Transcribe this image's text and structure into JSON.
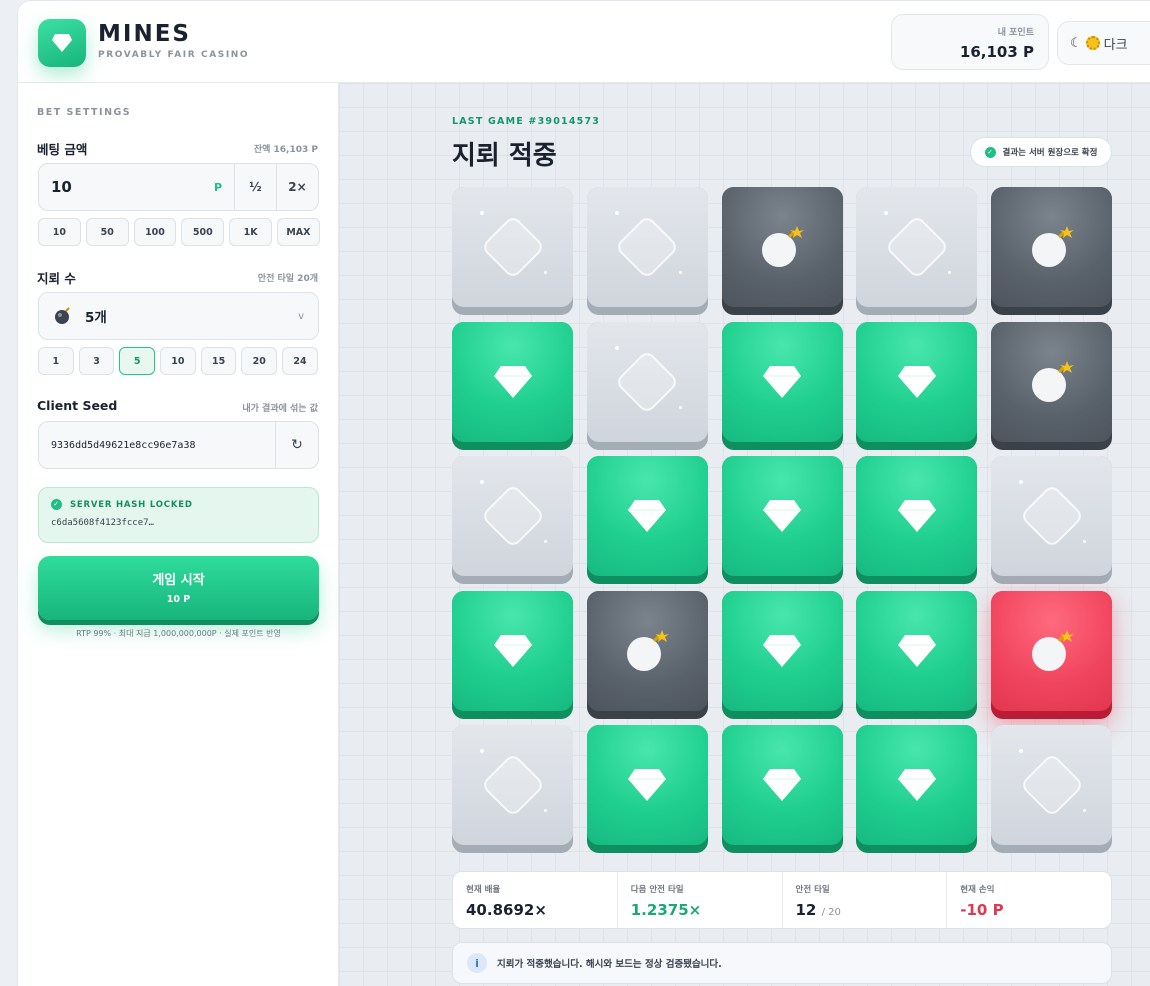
{
  "header": {
    "brand": "MINES",
    "tagline": "PROVABLY FAIR CASINO",
    "points_label": "내 포인트",
    "points_value": "16,103 P",
    "theme_label": "다크",
    "moon": "☾"
  },
  "sidebar": {
    "section_title": "BET SETTINGS",
    "bet_label": "베팅 금액",
    "balance_hint": "잔액 16,103 P",
    "bet_value": "10",
    "bet_unit": "P",
    "half_label": "½",
    "double_label": "2×",
    "bet_chips": [
      "10",
      "50",
      "100",
      "500",
      "1K",
      "MAX"
    ],
    "mines_label": "지뢰 수",
    "safe_hint": "안전 타일 20개",
    "mines_value": "5개",
    "mines_chevron": "v",
    "mine_chips": [
      "1",
      "3",
      "5",
      "10",
      "15",
      "20",
      "24"
    ],
    "mine_chip_selected": 2,
    "seed_label": "Client Seed",
    "seed_hint": "내가 결과에 섞는 값",
    "seed_value": "9336dd5d49621e8cc96e7a38",
    "refresh_glyph": "↻",
    "hash_title": "SERVER HASH LOCKED",
    "hash_value": "c6da5608f4123fcce7…",
    "start_label": "게임 시작",
    "start_amount": "10 P",
    "rtp_note": "RTP 99% · 최대 지급 1,000,000,000P · 실제 포인트 반영"
  },
  "main": {
    "last_game": "LAST GAME #39014573",
    "result_title": "지뢰 적중",
    "confirm_label": "결과는 서버 원장으로 확정",
    "tiles": [
      "hidden",
      "hidden",
      "bomb",
      "hidden",
      "bomb",
      "gem",
      "hidden",
      "gem",
      "gem",
      "bomb",
      "hidden",
      "gem",
      "gem",
      "gem",
      "hidden",
      "gem",
      "bomb",
      "gem",
      "gem",
      "boom",
      "hidden",
      "gem",
      "gem",
      "gem",
      "hidden"
    ],
    "stats": [
      {
        "label": "현재 배율",
        "value": "40.8692×",
        "color": "#1a2230",
        "sub": ""
      },
      {
        "label": "다음 안전 타일",
        "value": "1.2375×",
        "color": "#1aa874",
        "sub": ""
      },
      {
        "label": "안전 타일",
        "value": "12",
        "color": "#1a2230",
        "sub": "/ 20"
      },
      {
        "label": "현재 손익",
        "value": "-10 P",
        "color": "#e23651",
        "sub": ""
      }
    ],
    "info_icon": "i",
    "info_text": "지뢰가 적중했습니다. 해시와 보드는 정상 검증됐습니다."
  }
}
